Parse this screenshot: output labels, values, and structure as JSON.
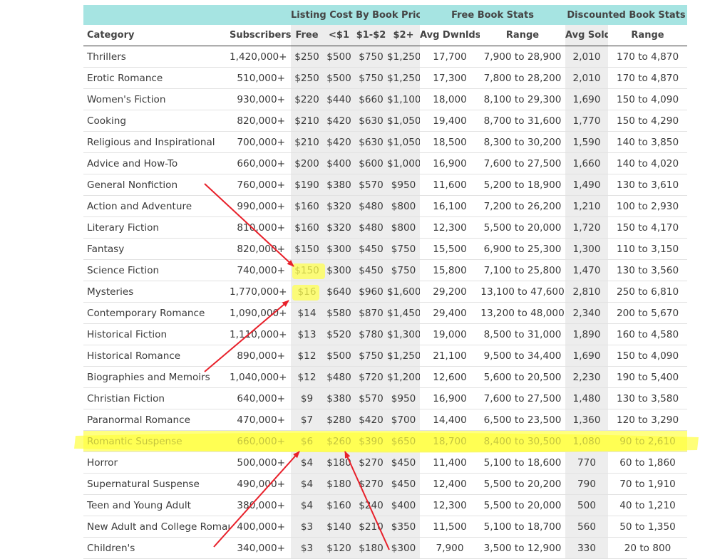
{
  "table": {
    "group_headers": {
      "listing": "Listing Cost By Book Price",
      "free_stats": "Free Book Stats",
      "discounted_stats": "Discounted Book Stats"
    },
    "columns": [
      "Category",
      "Subscribers",
      "Free",
      "<$1",
      "$1-$2",
      "$2+",
      "Avg Dwnlds",
      "Range",
      "Avg Sold",
      "Range"
    ],
    "rows": [
      [
        "Thrillers",
        "1,420,000+",
        "$250",
        "$500",
        "$750",
        "$1,250",
        "17,700",
        "7,900 to 28,900",
        "2,010",
        "170 to 4,870"
      ],
      [
        "Erotic Romance",
        "510,000+",
        "$250",
        "$500",
        "$750",
        "$1,250",
        "17,300",
        "7,800 to 28,200",
        "2,010",
        "170 to 4,870"
      ],
      [
        "Women's Fiction",
        "930,000+",
        "$220",
        "$440",
        "$660",
        "$1,100",
        "18,000",
        "8,100 to 29,300",
        "1,690",
        "150 to 4,090"
      ],
      [
        "Cooking",
        "820,000+",
        "$210",
        "$420",
        "$630",
        "$1,050",
        "19,400",
        "8,700 to 31,600",
        "1,770",
        "150 to 4,290"
      ],
      [
        "Religious and Inspirational",
        "700,000+",
        "$210",
        "$420",
        "$630",
        "$1,050",
        "18,500",
        "8,300 to 30,200",
        "1,590",
        "140 to 3,850"
      ],
      [
        "Advice and How-To",
        "660,000+",
        "$200",
        "$400",
        "$600",
        "$1,000",
        "16,900",
        "7,600 to 27,500",
        "1,660",
        "140 to 4,020"
      ],
      [
        "General Nonfiction",
        "760,000+",
        "$190",
        "$380",
        "$570",
        "$950",
        "11,600",
        "5,200 to 18,900",
        "1,490",
        "130 to 3,610"
      ],
      [
        "Action and Adventure",
        "990,000+",
        "$160",
        "$320",
        "$480",
        "$800",
        "16,100",
        "7,200 to 26,200",
        "1,210",
        "100 to 2,930"
      ],
      [
        "Literary Fiction",
        "810,000+",
        "$160",
        "$320",
        "$480",
        "$800",
        "12,300",
        "5,500 to 20,000",
        "1,720",
        "150 to 4,170"
      ],
      [
        "Fantasy",
        "820,000+",
        "$150",
        "$300",
        "$450",
        "$750",
        "15,500",
        "6,900 to 25,300",
        "1,300",
        "110 to 3,150"
      ],
      [
        "Science Fiction",
        "740,000+",
        "$150",
        "$300",
        "$450",
        "$750",
        "15,800",
        "7,100 to 25,800",
        "1,470",
        "130 to 3,560"
      ],
      [
        "Mysteries",
        "1,770,000+",
        "$16",
        "$640",
        "$960",
        "$1,600",
        "29,200",
        "13,100 to 47,600",
        "2,810",
        "250 to 6,810"
      ],
      [
        "Contemporary Romance",
        "1,090,000+",
        "$14",
        "$580",
        "$870",
        "$1,450",
        "29,400",
        "13,200 to 48,000",
        "2,340",
        "200 to 5,670"
      ],
      [
        "Historical Fiction",
        "1,110,000+",
        "$13",
        "$520",
        "$780",
        "$1,300",
        "19,000",
        "8,500 to 31,000",
        "1,890",
        "160 to 4,580"
      ],
      [
        "Historical Romance",
        "890,000+",
        "$12",
        "$500",
        "$750",
        "$1,250",
        "21,100",
        "9,500 to 34,400",
        "1,690",
        "150 to 4,090"
      ],
      [
        "Biographies and Memoirs",
        "1,040,000+",
        "$12",
        "$480",
        "$720",
        "$1,200",
        "12,600",
        "5,600 to 20,500",
        "2,230",
        "190 to 5,400"
      ],
      [
        "Christian Fiction",
        "640,000+",
        "$9",
        "$380",
        "$570",
        "$950",
        "16,900",
        "7,600 to 27,500",
        "1,480",
        "130 to 3,580"
      ],
      [
        "Paranormal Romance",
        "470,000+",
        "$7",
        "$280",
        "$420",
        "$700",
        "14,400",
        "6,500 to 23,500",
        "1,360",
        "120 to 3,290"
      ],
      [
        "Romantic Suspense",
        "660,000+",
        "$6",
        "$260",
        "$390",
        "$650",
        "18,700",
        "8,400 to 30,500",
        "1,080",
        "90 to 2,610"
      ],
      [
        "Horror",
        "500,000+",
        "$4",
        "$180",
        "$270",
        "$450",
        "11,400",
        "5,100 to 18,600",
        "770",
        "60 to 1,860"
      ],
      [
        "Supernatural Suspense",
        "490,000+",
        "$4",
        "$180",
        "$270",
        "$450",
        "12,400",
        "5,500 to 20,200",
        "790",
        "70 to 1,910"
      ],
      [
        "Teen and Young Adult",
        "380,000+",
        "$4",
        "$160",
        "$240",
        "$400",
        "12,300",
        "5,500 to 20,000",
        "500",
        "40 to 1,210"
      ],
      [
        "New Adult and College Romance",
        "400,000+",
        "$3",
        "$140",
        "$210",
        "$350",
        "11,500",
        "5,100 to 18,700",
        "560",
        "50 to 1,350"
      ],
      [
        "Children's",
        "340,000+",
        "$3",
        "$120",
        "$180",
        "$300",
        "7,900",
        "3,500 to 12,900",
        "330",
        "20 to 800"
      ]
    ],
    "highlighted_row": "Romantic Suspense",
    "highlighted_cells": [
      "Science Fiction",
      "Mysteries"
    ]
  },
  "colors": {
    "header_band": "#a6e4e2",
    "shaded_column": "#ededed",
    "highlighter": "#ffff66",
    "annotation_arrow": "#e8202a"
  }
}
